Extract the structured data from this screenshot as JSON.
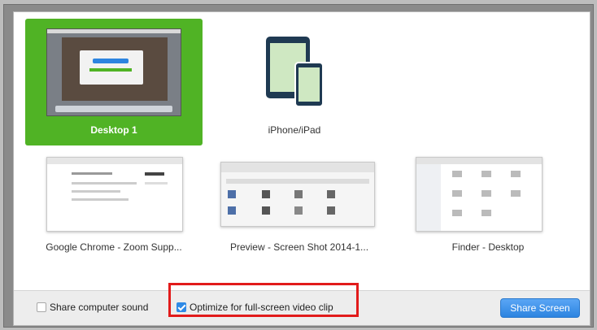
{
  "tiles": [
    {
      "label": "Desktop 1",
      "icon": "desktop-thumbnail",
      "selected": true
    },
    {
      "label": "iPhone/iPad",
      "icon": "tablet-phone-icon",
      "selected": false
    },
    {
      "label": "Google Chrome - Zoom Supp...",
      "icon": "browser-thumbnail",
      "selected": false
    },
    {
      "label": "Preview - Screen Shot 2014-1...",
      "icon": "preview-thumbnail",
      "selected": false
    },
    {
      "label": "Finder - Desktop",
      "icon": "finder-thumbnail",
      "selected": false
    }
  ],
  "options": {
    "share_sound_label": "Share computer sound",
    "share_sound_checked": false,
    "optimize_label": "Optimize for full-screen video clip",
    "optimize_checked": true
  },
  "share_button_label": "Share Screen",
  "colors": {
    "selected_green": "#50b325",
    "highlight_red": "#e21b1b",
    "button_blue": "#2d84e0",
    "device_navy": "#1f3a52",
    "device_screen": "#cfe8c2"
  }
}
